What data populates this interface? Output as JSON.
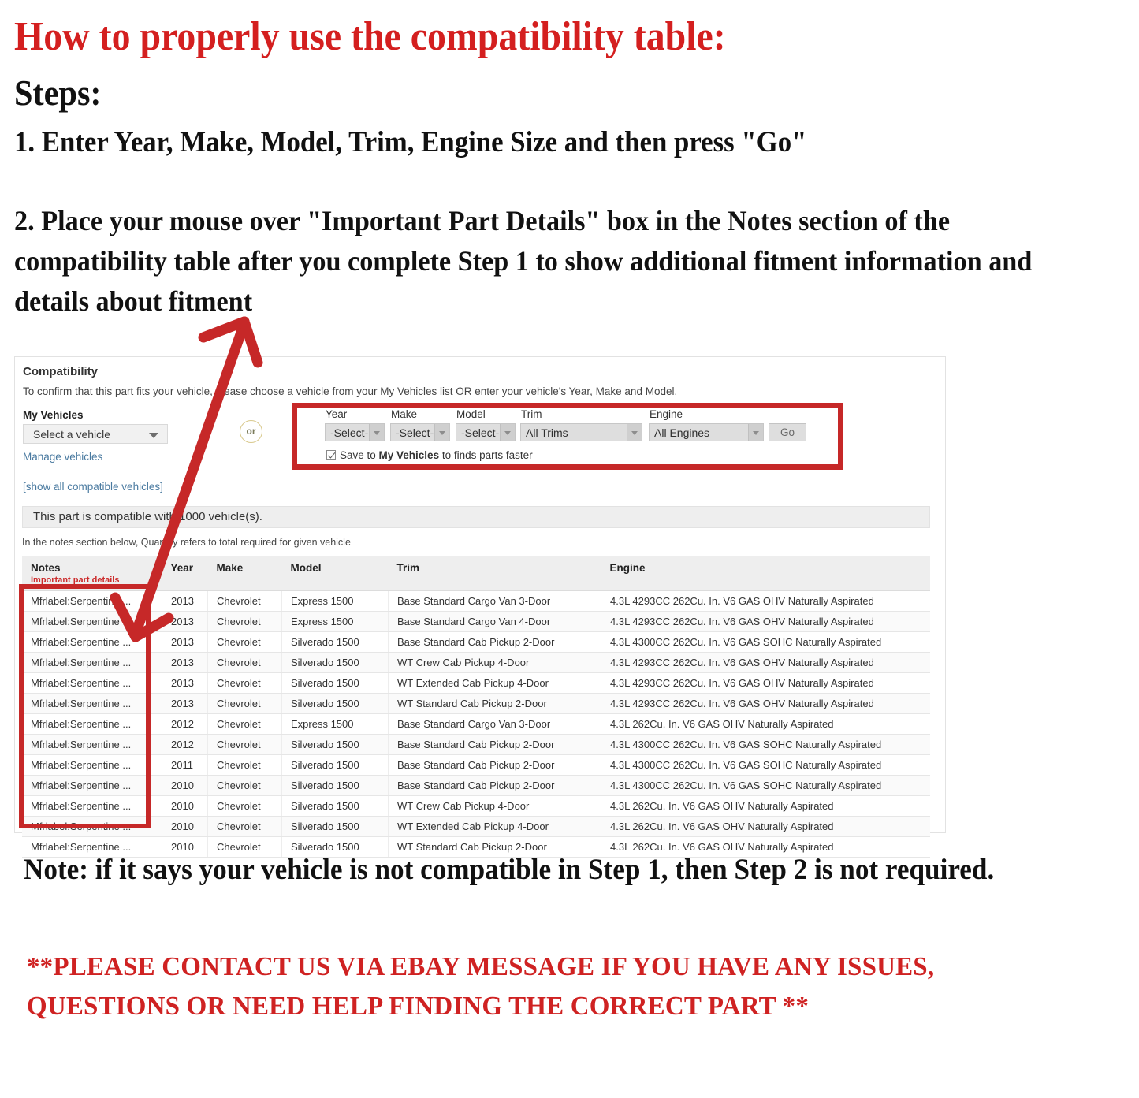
{
  "headings": {
    "title": "How to properly use the compatibility table:",
    "steps_label": "Steps:",
    "step1": "1. Enter Year, Make, Model, Trim, Engine Size and then press \"Go\"",
    "step2": "2. Place your mouse over \"Important Part Details\" box in the Notes section of the compatibility table after you complete Step 1 to show additional fitment information and details about fitment",
    "note": "Note: if it says your vehicle is not compatible in Step 1, then Step 2 is not required.",
    "contact": "**PLEASE CONTACT US VIA EBAY MESSAGE IF YOU HAVE ANY ISSUES, QUESTIONS OR NEED HELP FINDING THE CORRECT PART **"
  },
  "colors": {
    "heading_red": "#d41f1f",
    "contact_red": "#cf2222",
    "annotation_red": "#c62828",
    "link_blue": "#4a7aa0",
    "notes_red": "#cc2b2b"
  },
  "panel": {
    "title": "Compatibility",
    "subtitle": "To confirm that this part fits your vehicle, please choose a vehicle from your My Vehicles list OR enter your vehicle's Year, Make and Model.",
    "my_vehicles_label": "My Vehicles",
    "my_vehicles_value": "Select a vehicle",
    "manage_vehicles_link": "Manage vehicles",
    "show_all_link": "[show all compatible vehicles]",
    "or_separator": "or",
    "compat_count_text": "This part is compatible with 1000 vehicle(s).",
    "notes_hint": "In the notes section below, Quantity refers to total required for given vehicle"
  },
  "finder": {
    "fields": [
      {
        "label": "Year",
        "value": "-Select-"
      },
      {
        "label": "Make",
        "value": "-Select-"
      },
      {
        "label": "Model",
        "value": "-Select-"
      },
      {
        "label": "Trim",
        "value": "All Trims"
      },
      {
        "label": "Engine",
        "value": "All Engines"
      }
    ],
    "go_label": "Go",
    "save_prefix": "Save to ",
    "save_bold": "My Vehicles",
    "save_suffix": " to finds parts faster",
    "save_checked": true
  },
  "table": {
    "columns": [
      "Notes",
      "Year",
      "Make",
      "Model",
      "Trim",
      "Engine"
    ],
    "notes_subheader": "Important part details",
    "rows": [
      {
        "notes": "Mfrlabel:Serpentine ...",
        "year": "2013",
        "make": "Chevrolet",
        "model": "Express 1500",
        "trim": "Base Standard Cargo Van 3-Door",
        "engine": "4.3L 4293CC 262Cu. In. V6 GAS OHV Naturally Aspirated"
      },
      {
        "notes": "Mfrlabel:Serpentine ...",
        "year": "2013",
        "make": "Chevrolet",
        "model": "Express 1500",
        "trim": "Base Standard Cargo Van 4-Door",
        "engine": "4.3L 4293CC 262Cu. In. V6 GAS OHV Naturally Aspirated"
      },
      {
        "notes": "Mfrlabel:Serpentine ...",
        "year": "2013",
        "make": "Chevrolet",
        "model": "Silverado 1500",
        "trim": "Base Standard Cab Pickup 2-Door",
        "engine": "4.3L 4300CC 262Cu. In. V6 GAS SOHC Naturally Aspirated"
      },
      {
        "notes": "Mfrlabel:Serpentine ...",
        "year": "2013",
        "make": "Chevrolet",
        "model": "Silverado 1500",
        "trim": "WT Crew Cab Pickup 4-Door",
        "engine": "4.3L 4293CC 262Cu. In. V6 GAS OHV Naturally Aspirated"
      },
      {
        "notes": "Mfrlabel:Serpentine ...",
        "year": "2013",
        "make": "Chevrolet",
        "model": "Silverado 1500",
        "trim": "WT Extended Cab Pickup 4-Door",
        "engine": "4.3L 4293CC 262Cu. In. V6 GAS OHV Naturally Aspirated"
      },
      {
        "notes": "Mfrlabel:Serpentine ...",
        "year": "2013",
        "make": "Chevrolet",
        "model": "Silverado 1500",
        "trim": "WT Standard Cab Pickup 2-Door",
        "engine": "4.3L 4293CC 262Cu. In. V6 GAS OHV Naturally Aspirated"
      },
      {
        "notes": "Mfrlabel:Serpentine ...",
        "year": "2012",
        "make": "Chevrolet",
        "model": "Express 1500",
        "trim": "Base Standard Cargo Van 3-Door",
        "engine": "4.3L 262Cu. In. V6 GAS OHV Naturally Aspirated"
      },
      {
        "notes": "Mfrlabel:Serpentine ...",
        "year": "2012",
        "make": "Chevrolet",
        "model": "Silverado 1500",
        "trim": "Base Standard Cab Pickup 2-Door",
        "engine": "4.3L 4300CC 262Cu. In. V6 GAS SOHC Naturally Aspirated"
      },
      {
        "notes": "Mfrlabel:Serpentine ...",
        "year": "2011",
        "make": "Chevrolet",
        "model": "Silverado 1500",
        "trim": "Base Standard Cab Pickup 2-Door",
        "engine": "4.3L 4300CC 262Cu. In. V6 GAS SOHC Naturally Aspirated"
      },
      {
        "notes": "Mfrlabel:Serpentine ...",
        "year": "2010",
        "make": "Chevrolet",
        "model": "Silverado 1500",
        "trim": "Base Standard Cab Pickup 2-Door",
        "engine": "4.3L 4300CC 262Cu. In. V6 GAS SOHC Naturally Aspirated"
      },
      {
        "notes": "Mfrlabel:Serpentine ...",
        "year": "2010",
        "make": "Chevrolet",
        "model": "Silverado 1500",
        "trim": "WT Crew Cab Pickup 4-Door",
        "engine": "4.3L 262Cu. In. V6 GAS OHV Naturally Aspirated"
      },
      {
        "notes": "Mfrlabel:Serpentine ...",
        "year": "2010",
        "make": "Chevrolet",
        "model": "Silverado 1500",
        "trim": "WT Extended Cab Pickup 4-Door",
        "engine": "4.3L 262Cu. In. V6 GAS OHV Naturally Aspirated"
      },
      {
        "notes": "Mfrlabel:Serpentine ...",
        "year": "2010",
        "make": "Chevrolet",
        "model": "Silverado 1500",
        "trim": "WT Standard Cab Pickup 2-Door",
        "engine": "4.3L 262Cu. In. V6 GAS OHV Naturally Aspirated"
      }
    ]
  }
}
